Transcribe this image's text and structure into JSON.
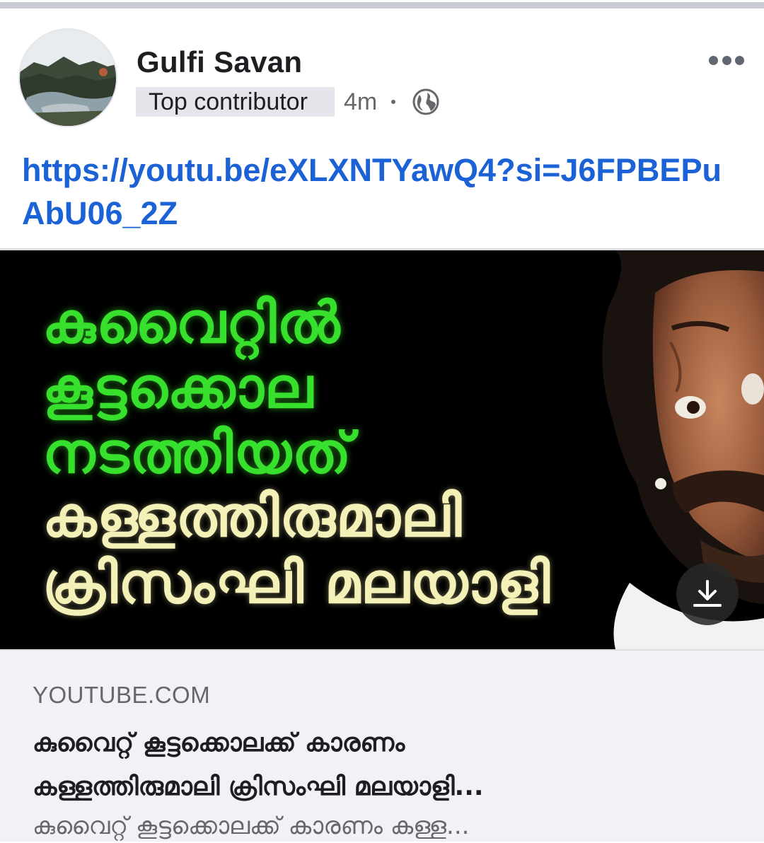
{
  "post": {
    "author": "Gulfi Savan",
    "badge": "Top contributor",
    "time": "4m",
    "audience_icon": "globe-icon",
    "more_icon": "more-options-icon",
    "link_text": "https://youtu.be/eXLXNTYawQ4?si=J6FPBEPuAbU06_2Z"
  },
  "thumbnail": {
    "lines": [
      "കുവൈറ്റിൽ",
      "കൂട്ടക്കൊല",
      "നടത്തിയത്",
      "കള്ളത്തിരുമാലി",
      "ക്രിസംഘി മലയാളി"
    ],
    "download_icon": "download-icon",
    "colors": {
      "green": "#36e02c",
      "cream": "#f3f0b8",
      "background": "#000000"
    }
  },
  "preview": {
    "domain": "YOUTUBE.COM",
    "title_line1": "കുവൈറ്റ് കൂട്ടക്കൊലക്ക് കാരണം",
    "title_line2": "കള്ളത്തിരുമാലി ക്രിസംഘി മലയാളി...",
    "description": "കുവൈറ്റ് കൂട്ടക്കൊലക്ക് കാരണം കള്ള..."
  },
  "colors": {
    "link": "#1a62d6",
    "text_primary": "#1c1e21",
    "text_secondary": "#65676b",
    "badge_bg": "#e4e6eb",
    "preview_bg": "#f0f2f5"
  }
}
